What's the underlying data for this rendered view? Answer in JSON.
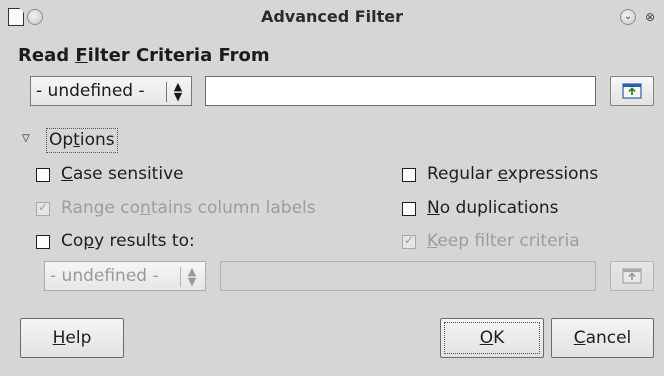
{
  "window": {
    "title": "Advanced Filter"
  },
  "read_criteria": {
    "label_pre": "Read ",
    "label_mnemonic": "F",
    "label_post": "ilter Criteria From",
    "combo_value": "- undefined -",
    "text_value": ""
  },
  "options": {
    "expander_pre": "Op",
    "expander_mnemonic": "t",
    "expander_post": "ions",
    "case_sensitive": {
      "mnemonic": "C",
      "rest": "ase sensitive",
      "checked": false,
      "enabled": true
    },
    "range_labels": {
      "pre": "Range co",
      "mnemonic": "n",
      "post": "tains column labels",
      "checked": true,
      "enabled": false
    },
    "copy_results": {
      "pre": "Co",
      "mnemonic": "p",
      "post": "y results to:",
      "checked": false,
      "enabled": true
    },
    "regex": {
      "pre": "Regular ",
      "mnemonic": "e",
      "post": "xpressions",
      "checked": false,
      "enabled": true
    },
    "no_dup": {
      "mnemonic": "N",
      "rest": "o duplications",
      "checked": false,
      "enabled": true
    },
    "keep_criteria": {
      "mnemonic": "K",
      "rest": "eep filter criteria",
      "checked": true,
      "enabled": false
    },
    "copy_combo_value": "- undefined -",
    "copy_text_value": ""
  },
  "buttons": {
    "help": {
      "mnemonic": "H",
      "rest": "elp"
    },
    "ok": {
      "mnemonic": "O",
      "rest": "K"
    },
    "cancel": {
      "mnemonic": "C",
      "rest": "ancel"
    }
  },
  "icons": {
    "window_doc": "document-icon",
    "window_menu": "window-menu-icon",
    "shrink": "chevron-down-icon",
    "close": "close-icon",
    "shrink_range": "shrink-range-icon",
    "expander": "triangle-down-icon"
  }
}
